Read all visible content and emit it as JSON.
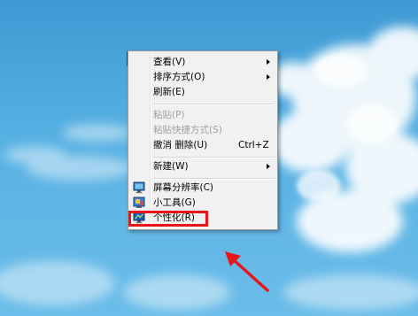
{
  "menu": {
    "items": [
      {
        "label": "查看(V)",
        "submenu": true
      },
      {
        "label": "排序方式(O)",
        "submenu": true
      },
      {
        "label": "刷新(E)"
      },
      {
        "label": "粘贴(P)",
        "disabled": true
      },
      {
        "label": "粘贴快捷方式(S)",
        "disabled": true
      },
      {
        "label": "撤消 删除(U)",
        "shortcut": "Ctrl+Z"
      },
      {
        "label": "新建(W)",
        "submenu": true
      },
      {
        "label": "屏幕分辨率(C)",
        "icon": "screen-resolution-icon"
      },
      {
        "label": "小工具(G)",
        "icon": "gadgets-icon"
      },
      {
        "label": "个性化(R)",
        "icon": "personalize-icon"
      }
    ]
  },
  "annotation": {
    "highlight_color": "#e8161b",
    "target": "personalize"
  },
  "colors": {
    "desktop_sky": "#4aa6dc",
    "menu_bg": "#f1f1f1"
  }
}
